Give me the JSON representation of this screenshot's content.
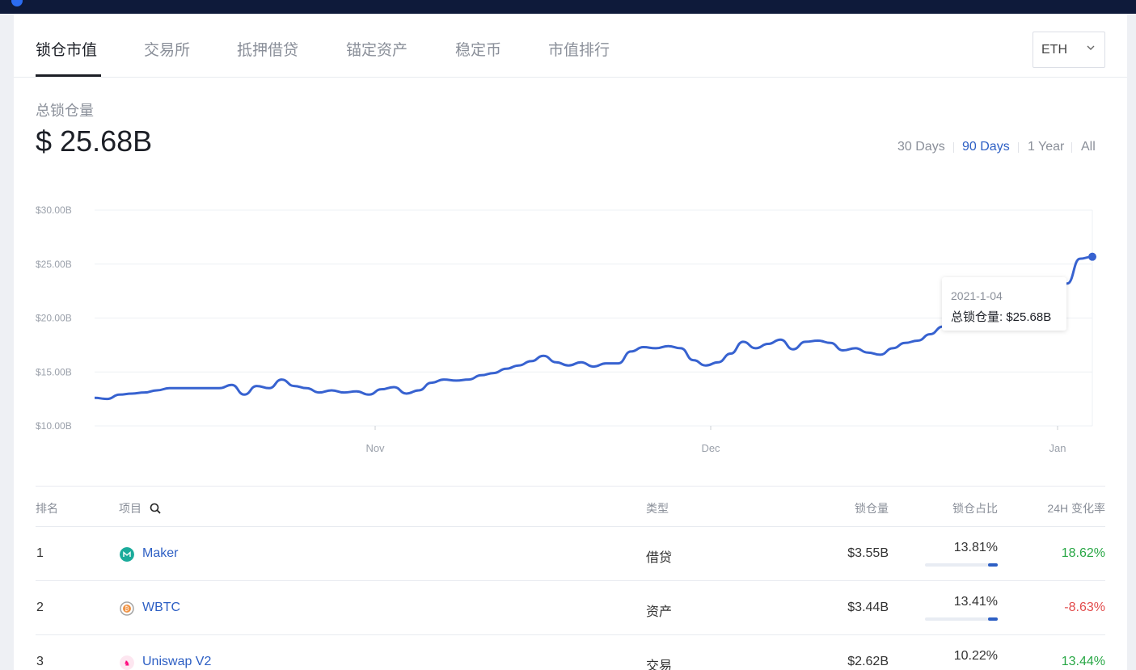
{
  "tabs": [
    "锁仓市值",
    "交易所",
    "抵押借贷",
    "锚定资产",
    "稳定币",
    "市值排行"
  ],
  "network_select": {
    "value": "ETH"
  },
  "summary": {
    "label": "总锁仓量",
    "value": "$ 25.68B"
  },
  "ranges": [
    "30 Days",
    "90 Days",
    "1 Year",
    "All"
  ],
  "active_range": "90 Days",
  "chart_data": {
    "type": "line",
    "series": [
      {
        "values": [
          12.6,
          12.5,
          12.9,
          13.0,
          13.1,
          13.3,
          13.5,
          13.5,
          13.5,
          13.5,
          13.5,
          13.8,
          12.9,
          13.7,
          13.5,
          14.3,
          13.7,
          13.5,
          13.1,
          13.3,
          13.1,
          13.2,
          12.9,
          13.4,
          13.6,
          13.0,
          13.3,
          14.0,
          14.3,
          14.2,
          14.3,
          14.7,
          14.9,
          15.3,
          15.6,
          16.0,
          16.5,
          15.9,
          15.6,
          15.9,
          15.5,
          15.8,
          15.8,
          16.9,
          17.3,
          17.2,
          17.4,
          17.2,
          16.1,
          15.6,
          15.9,
          16.7,
          17.8,
          17.2,
          17.6,
          18.0,
          17.1,
          17.8,
          17.9,
          17.7,
          17.0,
          17.2,
          16.8,
          16.6,
          17.2,
          17.7,
          17.9,
          18.5,
          19.2,
          19.4,
          20.0,
          19.6,
          19.2,
          20.1,
          21.5,
          22.0,
          22.3,
          22.5,
          23.2,
          25.5,
          25.68
        ],
        "color": "#3762d0"
      }
    ],
    "x_ticks": [
      "Nov",
      "Dec",
      "Jan"
    ],
    "y_ticks": [
      "$10.00B",
      "$15.00B",
      "$20.00B",
      "$25.00B",
      "$30.00B"
    ],
    "ylim": [
      10,
      30
    ],
    "grid": true,
    "tooltip": {
      "date": "2021-1-04",
      "label": "总锁仓量: $25.68B"
    }
  },
  "table": {
    "headers": [
      "排名",
      "项目",
      "类型",
      "锁仓量",
      "锁仓占比",
      "24H 变化率"
    ],
    "rows": [
      {
        "rank": "1",
        "name": "Maker",
        "type": "借贷",
        "tvl": "$3.55B",
        "share": "13.81%",
        "share_frac": 0.1381,
        "change": "18.62%",
        "change_dir": "pos",
        "icon": "maker-icon",
        "icon_color": "#1aab9b"
      },
      {
        "rank": "2",
        "name": "WBTC",
        "type": "资产",
        "tvl": "$3.44B",
        "share": "13.41%",
        "share_frac": 0.1341,
        "change": "-8.63%",
        "change_dir": "neg",
        "icon": "wbtc-icon",
        "icon_color": "#f09242"
      },
      {
        "rank": "3",
        "name": "Uniswap V2",
        "type": "交易",
        "tvl": "$2.62B",
        "share": "10.22%",
        "share_frac": 0.1022,
        "change": "13.44%",
        "change_dir": "pos",
        "icon": "uniswap-icon",
        "icon_color": "#ff007a"
      }
    ]
  }
}
